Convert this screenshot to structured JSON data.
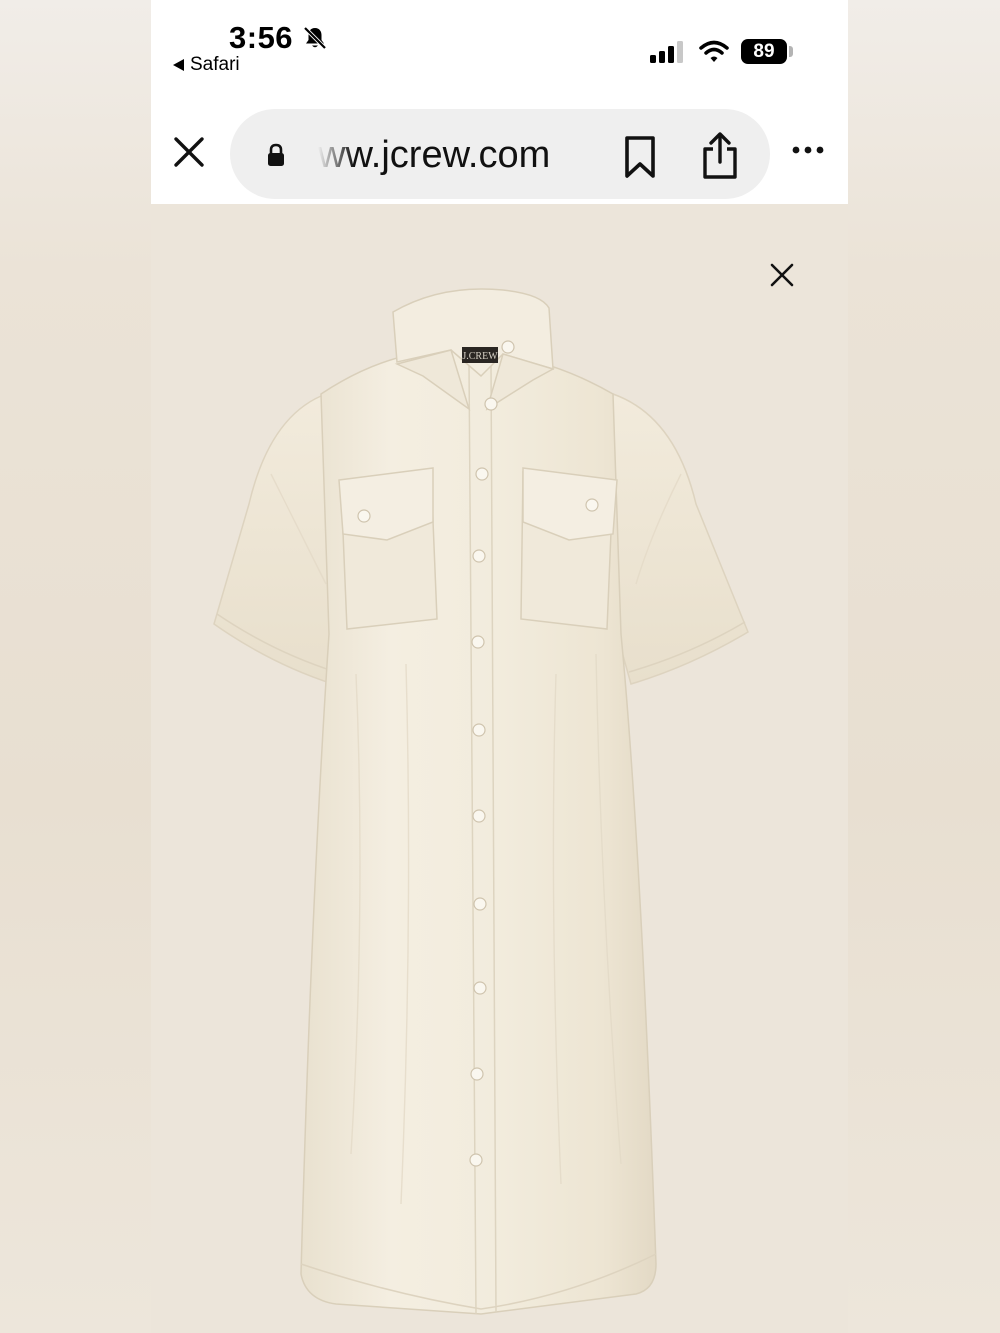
{
  "status_bar": {
    "time": "3:56",
    "back_app_label": "Safari",
    "battery_level": "89",
    "signal_bars_active": 3,
    "signal_bars_total": 4,
    "icons": [
      "bell-slash-icon",
      "signal-icon",
      "wifi-icon",
      "battery-icon"
    ]
  },
  "browser": {
    "url": "ww.jcrew.com",
    "icons": [
      "close-icon",
      "lock-icon",
      "bookmark-icon",
      "share-icon",
      "more-icon"
    ]
  },
  "product_view": {
    "image_subject": "cream linen short-sleeve shirt dress",
    "close_icon": "close-icon",
    "label_text": "J.CREW"
  },
  "colors": {
    "background": "#ece5da",
    "dress": "#f3eddf",
    "dress_shadow": "#e4dbc8",
    "buttons": "#faf7ef"
  }
}
